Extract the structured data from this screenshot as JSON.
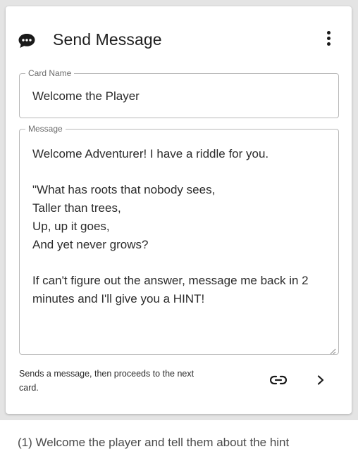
{
  "card": {
    "title": "Send Message",
    "title_icon": "chat-bubble-icon",
    "menu_icon": "more-vertical-icon"
  },
  "fields": {
    "card_name": {
      "label": "Card Name",
      "value": "Welcome the Player"
    },
    "message": {
      "label": "Message",
      "value": "Welcome Adventurer! I have a riddle for you.\n\n\"What has roots that nobody sees,\nTaller than trees,\nUp, up it goes,\nAnd yet never grows?\n\nIf can't figure out the answer, message me back in 2 minutes and I'll give you a HINT!"
    }
  },
  "footer": {
    "description": "Sends a message, then proceeds to the next card.",
    "link_icon": "link-icon",
    "next_icon": "chevron-right-icon"
  },
  "caption": "(1) Welcome the player and tell them about the hint"
}
